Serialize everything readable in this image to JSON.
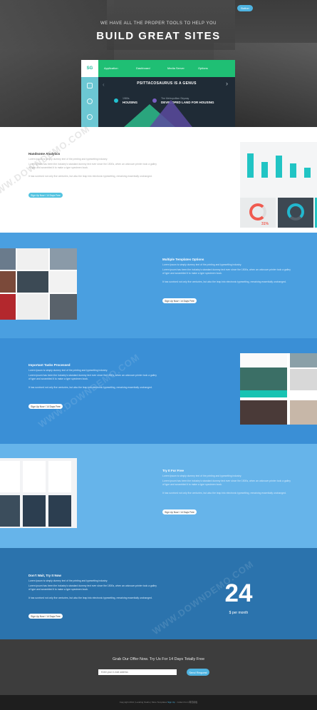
{
  "hero": {
    "top_button": "Button",
    "subtitle": "WE HAVE ALL THE PROPER TOOLS TO HELP YOU",
    "title": "BUILD GREAT SITES",
    "mockup": {
      "logo": "SG",
      "nav": [
        "Application",
        "Dashboard",
        "Media Server",
        "Options"
      ],
      "title": "PSITTACOSAURUS IS A GENUS",
      "stat1_label": "1980s",
      "stat1_value": "HOUSING",
      "stat2_label": "The Metropolitan Skyway",
      "stat2_value": "DEVELOPED LAND FOR HOUSING",
      "accent": "#1fbf74"
    }
  },
  "sections": [
    {
      "title": "Handsome Analytics",
      "paragraphs": [
        "Lorem Ipsum is simply dummy text of the printing and typesetting industry.",
        "Lorem ipsum has been the industry's standard dummy text ever since the 1500s, when an unknown printer took a galley of type and scrambled it to make a type specimen book.",
        "It has survived not only five centuries, but also the leap into electronic typesetting, remaining essentially unchanged."
      ],
      "button": "Sign Up Now / 14 Days Free"
    },
    {
      "title": "Multiple Templates Options",
      "paragraphs": [
        "Lorem Ipsum is simply dummy text of the printing and typesetting industry.",
        "Lorem ipsum has been the industry's standard dummy text ever since the 1500s, when an unknown printer took a galley of type and scrambled it to make a type specimen book.",
        "It has survived not only five centuries, but also the leap into electronic typesetting, remaining essentially unchanged."
      ],
      "button": "Sign Up Now / 14 Days Free"
    },
    {
      "title": "Important Tasks Processed",
      "paragraphs": [
        "Lorem Ipsum is simply dummy text of the printing and typesetting industry.",
        "Lorem ipsum has been the industry's standard dummy text ever since the 1500s, when an unknown printer took a galley of type and scrambled it to make a type specimen book.",
        "It has survived not only five centuries, but also the leap into electronic typesetting, remaining essentially unchanged."
      ],
      "button": "Sign Up Now / 14 Days Free"
    },
    {
      "title": "Try It For Free",
      "paragraphs": [
        "Lorem Ipsum is simply dummy text of the printing and typesetting industry.",
        "Lorem ipsum has been the industry's standard dummy text ever since the 1500s, when an unknown printer took a galley of type and scrambled it to make a type specimen book.",
        "It has survived not only five centuries, but also the leap into electronic typesetting, remaining essentially unchanged."
      ],
      "button": "Sign Up Now / 14 Days Free"
    },
    {
      "title": "Don't Wait, Try It Now",
      "paragraphs": [
        "Lorem Ipsum is simply dummy text of the printing and typesetting industry.",
        "Lorem ipsum has been the industry's standard dummy text ever since the 1500s, when an unknown printer took a galley of type and scrambled it to make a type specimen book.",
        "It has survived not only five centuries, but also the leap into electronic typesetting, remaining essentially unchanged."
      ],
      "button": "Sign Up Now / 14 Days Free"
    }
  ],
  "analytics": {
    "bar_levels": [
      0.85,
      0.55,
      0.78,
      0.5,
      0.36
    ],
    "percent": "31%"
  },
  "pricing": {
    "amount": "24",
    "period": "$ per month"
  },
  "offer": {
    "title": "Grab Our Offer Now. Try Us For 14 Days Totally Free",
    "email_placeholder": "Enter your e-mail address",
    "send": "Send Request"
  },
  "footer": {
    "text": "Copyright 2014 | Landing Studio | More Templates",
    "link": "Sign Up",
    "suffix": "· Collect from 网页模板"
  },
  "watermark": "WWW.DOWNDEMO.COM",
  "colors": {
    "blue": "#4a9fe0",
    "teal": "#21c4c4",
    "green": "#1fbf74",
    "dark": "#3d3d3d"
  }
}
